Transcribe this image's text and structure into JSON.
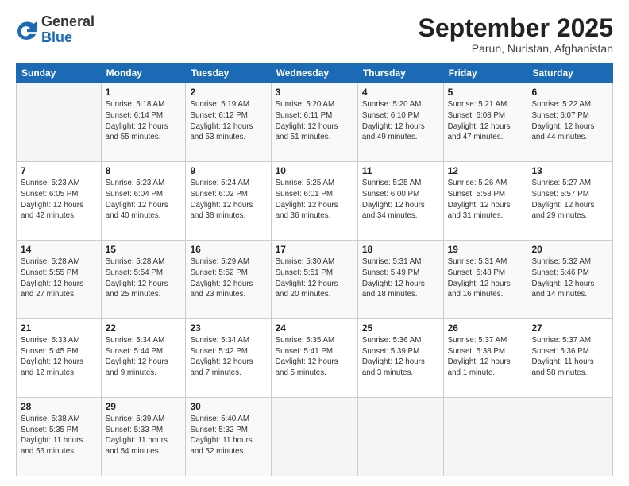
{
  "header": {
    "logo_general": "General",
    "logo_blue": "Blue",
    "month_title": "September 2025",
    "location": "Parun, Nuristan, Afghanistan"
  },
  "days_of_week": [
    "Sunday",
    "Monday",
    "Tuesday",
    "Wednesday",
    "Thursday",
    "Friday",
    "Saturday"
  ],
  "weeks": [
    [
      {
        "day": "",
        "info": ""
      },
      {
        "day": "1",
        "info": "Sunrise: 5:18 AM\nSunset: 6:14 PM\nDaylight: 12 hours\nand 55 minutes."
      },
      {
        "day": "2",
        "info": "Sunrise: 5:19 AM\nSunset: 6:12 PM\nDaylight: 12 hours\nand 53 minutes."
      },
      {
        "day": "3",
        "info": "Sunrise: 5:20 AM\nSunset: 6:11 PM\nDaylight: 12 hours\nand 51 minutes."
      },
      {
        "day": "4",
        "info": "Sunrise: 5:20 AM\nSunset: 6:10 PM\nDaylight: 12 hours\nand 49 minutes."
      },
      {
        "day": "5",
        "info": "Sunrise: 5:21 AM\nSunset: 6:08 PM\nDaylight: 12 hours\nand 47 minutes."
      },
      {
        "day": "6",
        "info": "Sunrise: 5:22 AM\nSunset: 6:07 PM\nDaylight: 12 hours\nand 44 minutes."
      }
    ],
    [
      {
        "day": "7",
        "info": "Sunrise: 5:23 AM\nSunset: 6:05 PM\nDaylight: 12 hours\nand 42 minutes."
      },
      {
        "day": "8",
        "info": "Sunrise: 5:23 AM\nSunset: 6:04 PM\nDaylight: 12 hours\nand 40 minutes."
      },
      {
        "day": "9",
        "info": "Sunrise: 5:24 AM\nSunset: 6:02 PM\nDaylight: 12 hours\nand 38 minutes."
      },
      {
        "day": "10",
        "info": "Sunrise: 5:25 AM\nSunset: 6:01 PM\nDaylight: 12 hours\nand 36 minutes."
      },
      {
        "day": "11",
        "info": "Sunrise: 5:25 AM\nSunset: 6:00 PM\nDaylight: 12 hours\nand 34 minutes."
      },
      {
        "day": "12",
        "info": "Sunrise: 5:26 AM\nSunset: 5:58 PM\nDaylight: 12 hours\nand 31 minutes."
      },
      {
        "day": "13",
        "info": "Sunrise: 5:27 AM\nSunset: 5:57 PM\nDaylight: 12 hours\nand 29 minutes."
      }
    ],
    [
      {
        "day": "14",
        "info": "Sunrise: 5:28 AM\nSunset: 5:55 PM\nDaylight: 12 hours\nand 27 minutes."
      },
      {
        "day": "15",
        "info": "Sunrise: 5:28 AM\nSunset: 5:54 PM\nDaylight: 12 hours\nand 25 minutes."
      },
      {
        "day": "16",
        "info": "Sunrise: 5:29 AM\nSunset: 5:52 PM\nDaylight: 12 hours\nand 23 minutes."
      },
      {
        "day": "17",
        "info": "Sunrise: 5:30 AM\nSunset: 5:51 PM\nDaylight: 12 hours\nand 20 minutes."
      },
      {
        "day": "18",
        "info": "Sunrise: 5:31 AM\nSunset: 5:49 PM\nDaylight: 12 hours\nand 18 minutes."
      },
      {
        "day": "19",
        "info": "Sunrise: 5:31 AM\nSunset: 5:48 PM\nDaylight: 12 hours\nand 16 minutes."
      },
      {
        "day": "20",
        "info": "Sunrise: 5:32 AM\nSunset: 5:46 PM\nDaylight: 12 hours\nand 14 minutes."
      }
    ],
    [
      {
        "day": "21",
        "info": "Sunrise: 5:33 AM\nSunset: 5:45 PM\nDaylight: 12 hours\nand 12 minutes."
      },
      {
        "day": "22",
        "info": "Sunrise: 5:34 AM\nSunset: 5:44 PM\nDaylight: 12 hours\nand 9 minutes."
      },
      {
        "day": "23",
        "info": "Sunrise: 5:34 AM\nSunset: 5:42 PM\nDaylight: 12 hours\nand 7 minutes."
      },
      {
        "day": "24",
        "info": "Sunrise: 5:35 AM\nSunset: 5:41 PM\nDaylight: 12 hours\nand 5 minutes."
      },
      {
        "day": "25",
        "info": "Sunrise: 5:36 AM\nSunset: 5:39 PM\nDaylight: 12 hours\nand 3 minutes."
      },
      {
        "day": "26",
        "info": "Sunrise: 5:37 AM\nSunset: 5:38 PM\nDaylight: 12 hours\nand 1 minute."
      },
      {
        "day": "27",
        "info": "Sunrise: 5:37 AM\nSunset: 5:36 PM\nDaylight: 11 hours\nand 58 minutes."
      }
    ],
    [
      {
        "day": "28",
        "info": "Sunrise: 5:38 AM\nSunset: 5:35 PM\nDaylight: 11 hours\nand 56 minutes."
      },
      {
        "day": "29",
        "info": "Sunrise: 5:39 AM\nSunset: 5:33 PM\nDaylight: 11 hours\nand 54 minutes."
      },
      {
        "day": "30",
        "info": "Sunrise: 5:40 AM\nSunset: 5:32 PM\nDaylight: 11 hours\nand 52 minutes."
      },
      {
        "day": "",
        "info": ""
      },
      {
        "day": "",
        "info": ""
      },
      {
        "day": "",
        "info": ""
      },
      {
        "day": "",
        "info": ""
      }
    ]
  ]
}
